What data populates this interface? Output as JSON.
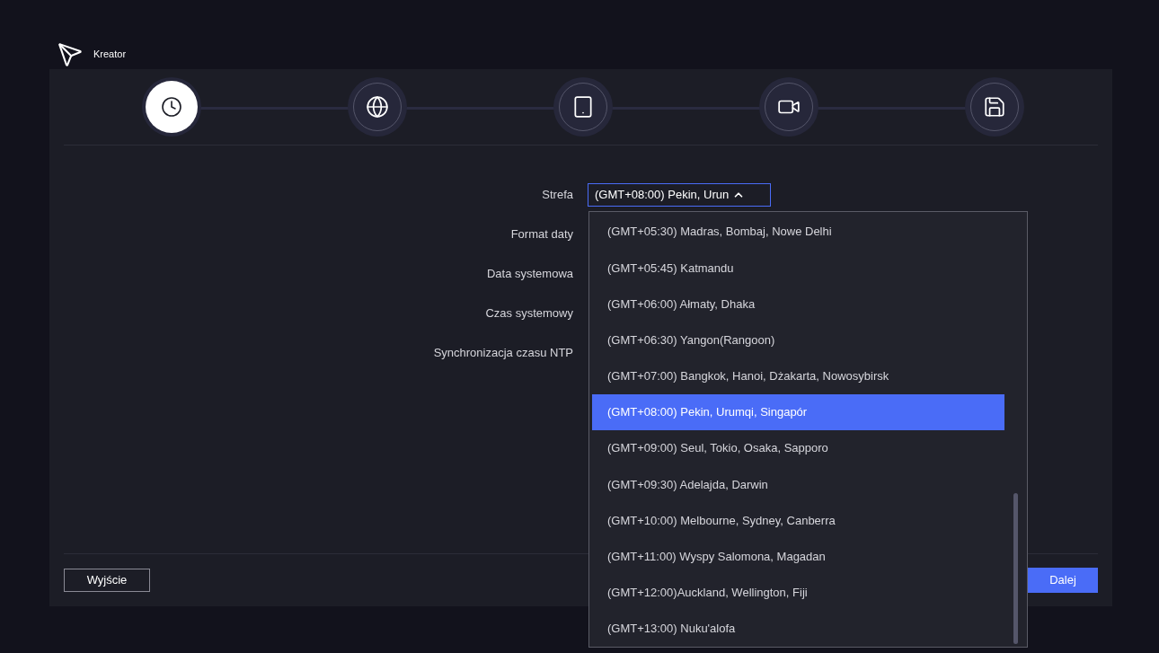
{
  "header": {
    "title": "Kreator"
  },
  "steps": [
    {
      "kind": "clock",
      "selected": true
    },
    {
      "kind": "globe",
      "selected": false
    },
    {
      "kind": "tablet",
      "selected": false
    },
    {
      "kind": "camera",
      "selected": false
    },
    {
      "kind": "save",
      "selected": false
    }
  ],
  "form": {
    "fields": [
      {
        "label": "Strefa",
        "kind": "select",
        "value": "(GMT+08:00) Pekin, Urun",
        "expanded": true
      },
      {
        "label": "Format daty",
        "kind": "text"
      },
      {
        "label": "Data systemowa",
        "kind": "text"
      },
      {
        "label": "Czas systemowy",
        "kind": "text"
      },
      {
        "label": "Synchronizacja czasu NTP",
        "kind": "text"
      }
    ]
  },
  "dropdown": {
    "options": [
      {
        "label": "(GMT+05:30) Madras, Bombaj, Nowe Delhi",
        "selected": false
      },
      {
        "label": "(GMT+05:45) Katmandu",
        "selected": false
      },
      {
        "label": "(GMT+06:00) Ałmaty, Dhaka",
        "selected": false
      },
      {
        "label": "(GMT+06:30) Yangon(Rangoon)",
        "selected": false
      },
      {
        "label": "(GMT+07:00) Bangkok, Hanoi, Dżakarta, Nowosybirsk",
        "selected": false
      },
      {
        "label": "(GMT+08:00) Pekin, Urumqi, Singapór",
        "selected": true
      },
      {
        "label": "(GMT+09:00) Seul, Tokio, Osaka, Sapporo",
        "selected": false
      },
      {
        "label": "(GMT+09:30) Adelajda, Darwin",
        "selected": false
      },
      {
        "label": "(GMT+10:00) Melbourne, Sydney, Canberra",
        "selected": false
      },
      {
        "label": "(GMT+11:00) Wyspy Salomona, Magadan",
        "selected": false
      },
      {
        "label": "(GMT+12:00)Auckland, Wellington, Fiji",
        "selected": false
      },
      {
        "label": "(GMT+13:00) Nuku'alofa",
        "selected": false
      }
    ]
  },
  "footer": {
    "exit": "Wyjście",
    "next": "Dalej"
  }
}
